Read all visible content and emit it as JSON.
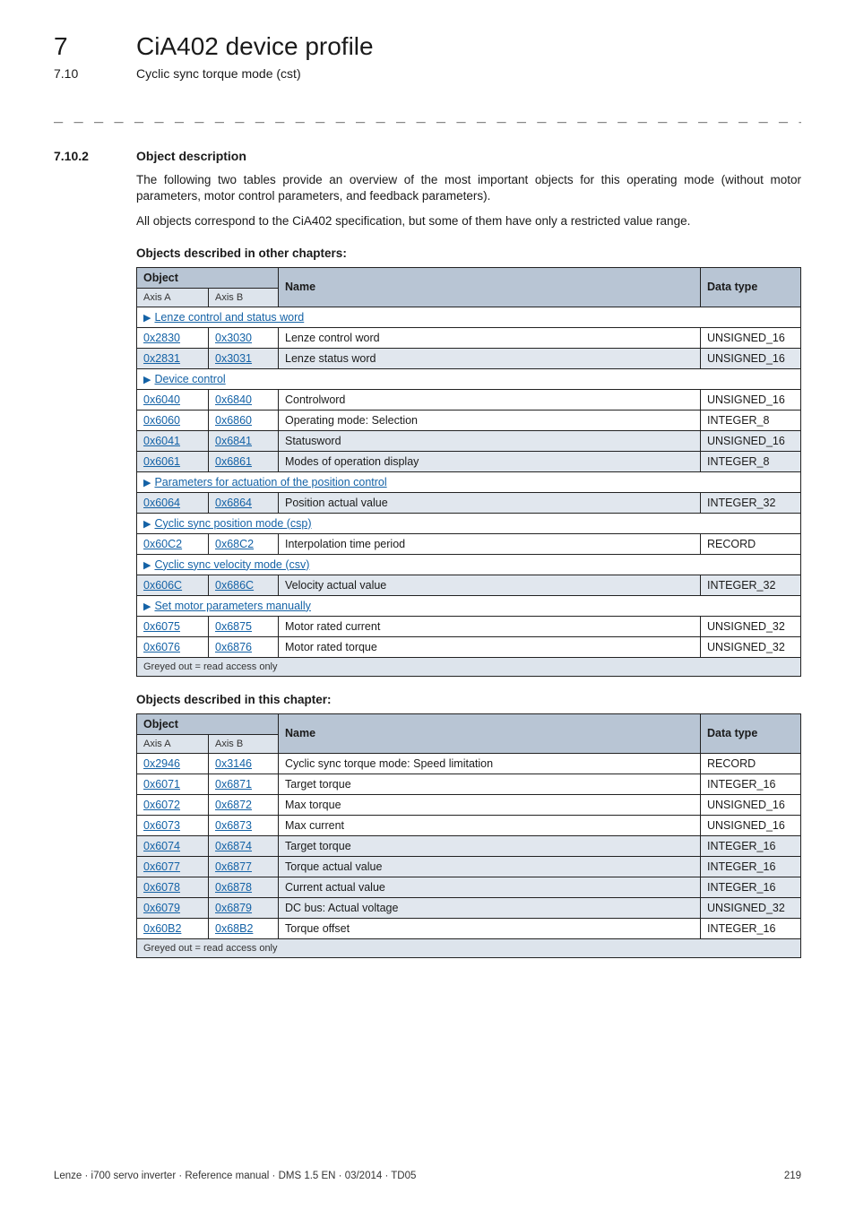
{
  "header": {
    "chapter_num": "7",
    "chapter_title": "CiA402 device profile",
    "section_num": "7.10",
    "section_title": "Cyclic sync torque mode (cst)"
  },
  "dashes": "_ _ _ _ _ _ _ _ _ _ _ _ _ _ _ _ _ _ _ _ _ _ _ _ _ _ _ _ _ _ _ _ _ _ _ _ _ _ _ _ _ _ _ _ _ _ _ _ _ _ _ _ _ _ _ _ _ _ _ _ _ _ _ _",
  "subsection": {
    "num": "7.10.2",
    "title": "Object description"
  },
  "paragraphs": {
    "p1": "The following two tables provide an overview of the most important objects for this operating mode (without motor parameters, motor control parameters, and feedback parameters).",
    "p2": "All objects correspond to the CiA402 specification, but some of them have only a restricted value range."
  },
  "table1": {
    "caption": "Objects described in other chapters:",
    "headers": {
      "object": "Object",
      "name": "Name",
      "datatype": "Data type",
      "axisA": "Axis A",
      "axisB": "Axis B"
    },
    "groups": [
      {
        "label": "Lenze control and status word",
        "rows": [
          {
            "a": "0x2830",
            "b": "0x3030",
            "name": "Lenze control word",
            "type": "UNSIGNED_16",
            "grey": false
          },
          {
            "a": "0x2831",
            "b": "0x3031",
            "name": "Lenze status word",
            "type": "UNSIGNED_16",
            "grey": true
          }
        ]
      },
      {
        "label": "Device control",
        "rows": [
          {
            "a": "0x6040",
            "b": "0x6840",
            "name": "Controlword",
            "type": "UNSIGNED_16",
            "grey": false
          },
          {
            "a": "0x6060",
            "b": "0x6860",
            "name": "Operating mode: Selection",
            "type": "INTEGER_8",
            "grey": false
          },
          {
            "a": "0x6041",
            "b": "0x6841",
            "name": "Statusword",
            "type": "UNSIGNED_16",
            "grey": true
          },
          {
            "a": "0x6061",
            "b": "0x6861",
            "name": "Modes of operation display",
            "type": "INTEGER_8",
            "grey": true
          }
        ]
      },
      {
        "label": "Parameters for actuation of the position control",
        "rows": [
          {
            "a": "0x6064",
            "b": "0x6864",
            "name": "Position actual value",
            "type": "INTEGER_32",
            "grey": true
          }
        ]
      },
      {
        "label": "Cyclic sync position mode (csp)",
        "rows": [
          {
            "a": "0x60C2",
            "b": "0x68C2",
            "name": "Interpolation time period",
            "type": "RECORD",
            "grey": false
          }
        ]
      },
      {
        "label": "Cyclic sync velocity mode (csv)",
        "rows": [
          {
            "a": "0x606C",
            "b": "0x686C",
            "name": "Velocity actual value",
            "type": "INTEGER_32",
            "grey": true
          }
        ]
      },
      {
        "label": "Set motor parameters manually",
        "rows": [
          {
            "a": "0x6075",
            "b": "0x6875",
            "name": "Motor rated current",
            "type": "UNSIGNED_32",
            "grey": false
          },
          {
            "a": "0x6076",
            "b": "0x6876",
            "name": "Motor rated torque",
            "type": "UNSIGNED_32",
            "grey": false
          }
        ]
      }
    ],
    "footnote": "Greyed out = read access only"
  },
  "table2": {
    "caption": "Objects described in this chapter:",
    "headers": {
      "object": "Object",
      "name": "Name",
      "datatype": "Data type",
      "axisA": "Axis A",
      "axisB": "Axis B"
    },
    "rows": [
      {
        "a": "0x2946",
        "b": "0x3146",
        "name": "Cyclic sync torque mode: Speed limitation",
        "type": "RECORD",
        "grey": false
      },
      {
        "a": "0x6071",
        "b": "0x6871",
        "name": "Target torque",
        "type": "INTEGER_16",
        "grey": false
      },
      {
        "a": "0x6072",
        "b": "0x6872",
        "name": "Max torque",
        "type": "UNSIGNED_16",
        "grey": false
      },
      {
        "a": "0x6073",
        "b": "0x6873",
        "name": "Max current",
        "type": "UNSIGNED_16",
        "grey": false
      },
      {
        "a": "0x6074",
        "b": "0x6874",
        "name": "Target torque",
        "type": "INTEGER_16",
        "grey": true
      },
      {
        "a": "0x6077",
        "b": "0x6877",
        "name": "Torque actual value",
        "type": "INTEGER_16",
        "grey": true
      },
      {
        "a": "0x6078",
        "b": "0x6878",
        "name": "Current actual value",
        "type": "INTEGER_16",
        "grey": true
      },
      {
        "a": "0x6079",
        "b": "0x6879",
        "name": "DC bus: Actual voltage",
        "type": "UNSIGNED_32",
        "grey": true
      },
      {
        "a": "0x60B2",
        "b": "0x68B2",
        "name": "Torque offset",
        "type": "INTEGER_16",
        "grey": false
      }
    ],
    "footnote": "Greyed out = read access only"
  },
  "footer": {
    "left": "Lenze · i700 servo inverter · Reference manual · DMS 1.5 EN · 03/2014 · TD05",
    "right": "219"
  }
}
